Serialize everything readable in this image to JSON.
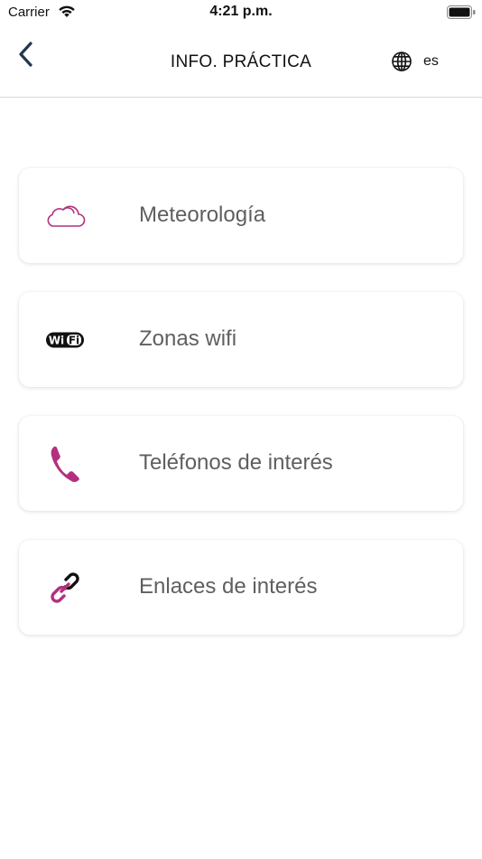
{
  "status": {
    "carrier": "Carrier",
    "time": "4:21 p.m."
  },
  "nav": {
    "title": "INFO. PRÁCTICA",
    "language": "es"
  },
  "colors": {
    "accent": "#b3307f",
    "text": "#5f5f5f",
    "divider": "#d8d8d8"
  },
  "menu": [
    {
      "label": "Meteorología",
      "icon": "cloud-icon"
    },
    {
      "label": "Zonas wifi",
      "icon": "wifi-icon"
    },
    {
      "label": "Teléfonos de interés",
      "icon": "phone-icon"
    },
    {
      "label": "Enlaces de interés",
      "icon": "link-icon"
    }
  ]
}
